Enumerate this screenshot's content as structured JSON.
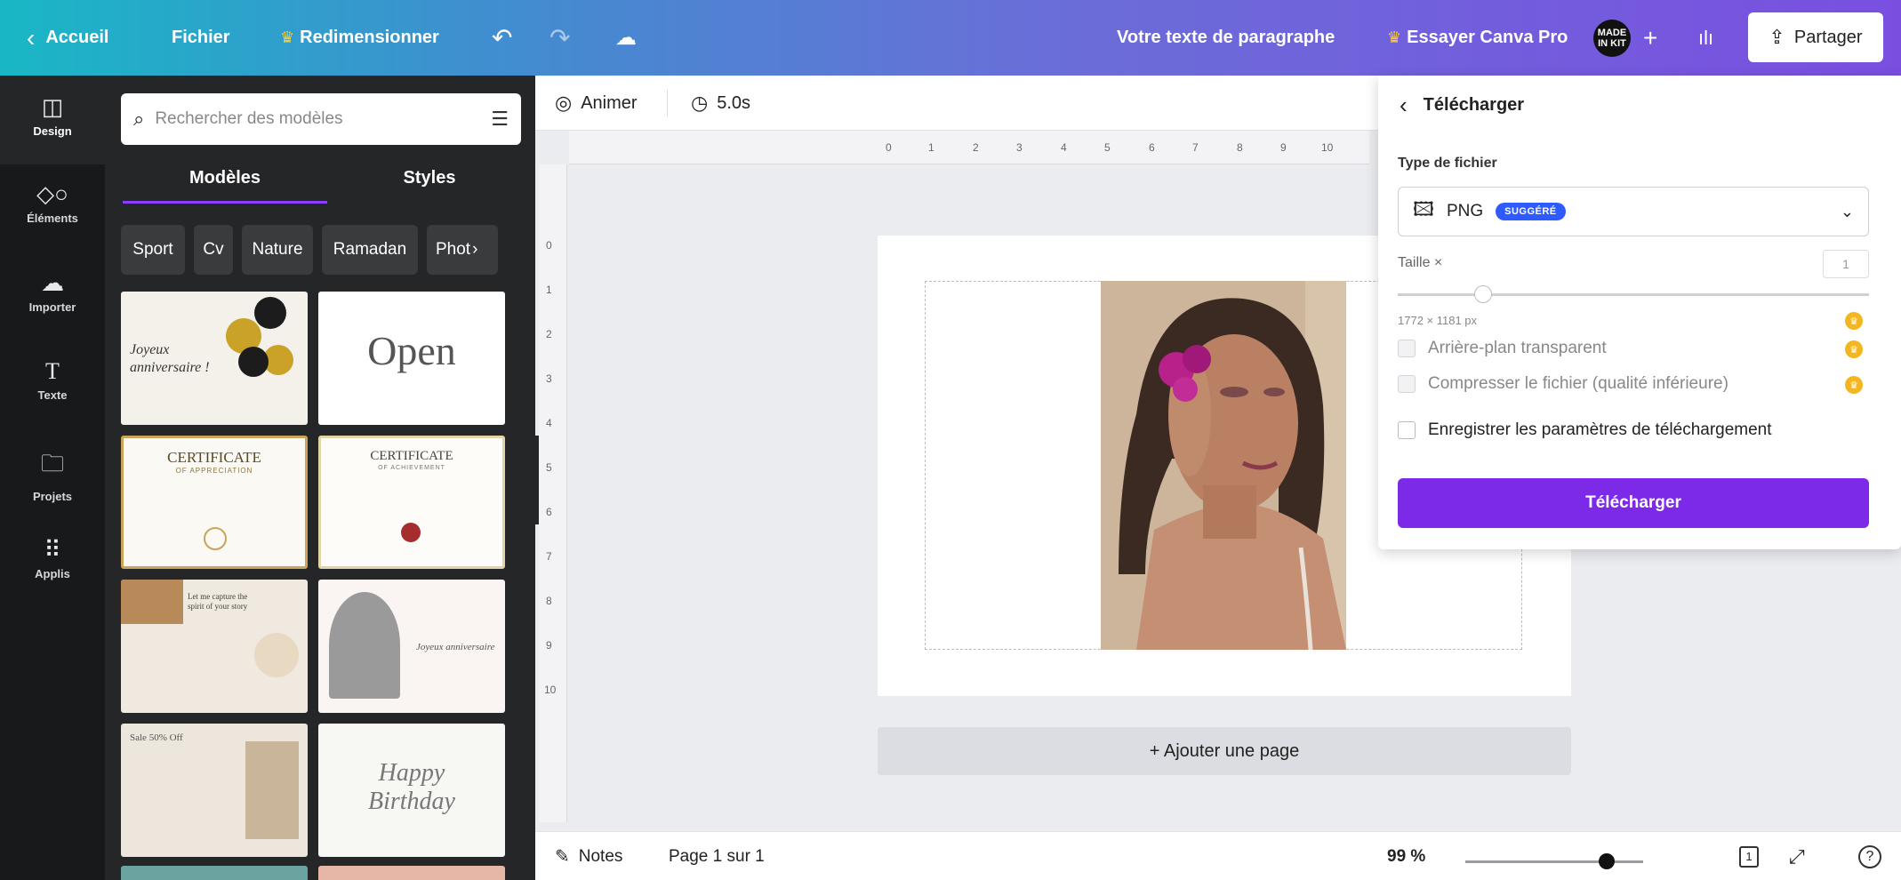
{
  "topbar": {
    "back_label": "Accueil",
    "file_label": "Fichier",
    "resize_label": "Redimensionner",
    "doc_title": "Votre texte de paragraphe",
    "pro_label": "Essayer Canva Pro",
    "avatar_text": "MADE IN KIT",
    "share_label": "Partager"
  },
  "rail": {
    "items": [
      {
        "label": "Design",
        "icon": "layout-icon"
      },
      {
        "label": "Éléments",
        "icon": "shapes-icon"
      },
      {
        "label": "Importer",
        "icon": "upload-cloud-icon"
      },
      {
        "label": "Texte",
        "icon": "text-icon"
      },
      {
        "label": "Projets",
        "icon": "folder-icon"
      },
      {
        "label": "Applis",
        "icon": "apps-grid-icon"
      }
    ]
  },
  "panel": {
    "search_placeholder": "Rechercher des modèles",
    "tabs": [
      "Modèles",
      "Styles"
    ],
    "chips": [
      "Sport",
      "Cv",
      "Nature",
      "Ramadan",
      "Phot"
    ],
    "templates": [
      {
        "text": "Joyeux anniversaire !"
      },
      {
        "text": "Open"
      },
      {
        "text": "CERTIFICATE",
        "sub": "OF APPRECIATION"
      },
      {
        "text": "CERTIFICATE",
        "sub": "OF ACHIEVEMENT"
      },
      {
        "text": "Let me capture the spirit of your story"
      },
      {
        "text": "Joyeux anniversaire"
      },
      {
        "text": "Sale 50% Off"
      },
      {
        "text": "Happy Birthday"
      }
    ]
  },
  "editor": {
    "animate_label": "Animer",
    "duration": "5.0s",
    "ruler_h": [
      "0",
      "1",
      "2",
      "3",
      "4",
      "5",
      "6",
      "7",
      "8",
      "9",
      "10"
    ],
    "ruler_v": [
      "0",
      "1",
      "2",
      "3",
      "4",
      "5",
      "6",
      "7",
      "8",
      "9",
      "10"
    ],
    "add_page_label": "+ Ajouter une page"
  },
  "bottombar": {
    "notes_label": "Notes",
    "page_label": "Page 1 sur 1",
    "zoom": "99 %",
    "page_count": "1",
    "help": "?"
  },
  "download": {
    "title": "Télécharger",
    "file_type_label": "Type de fichier",
    "file_type": "PNG",
    "suggested_badge": "SUGGÉRÉ",
    "size_label": "Taille ×",
    "size_value": "1",
    "dimensions": "1772 × 1181 px",
    "transparent_label": "Arrière-plan transparent",
    "compress_label": "Compresser le fichier (qualité inférieure)",
    "save_settings_label": "Enregistrer les paramètres de téléchargement",
    "button_label": "Télécharger"
  },
  "colors": {
    "accent": "#7d2ae8",
    "badge": "#2d5bff",
    "pro": "#f3b61f",
    "rail_bg": "#18191b",
    "panel_bg": "#252627"
  }
}
